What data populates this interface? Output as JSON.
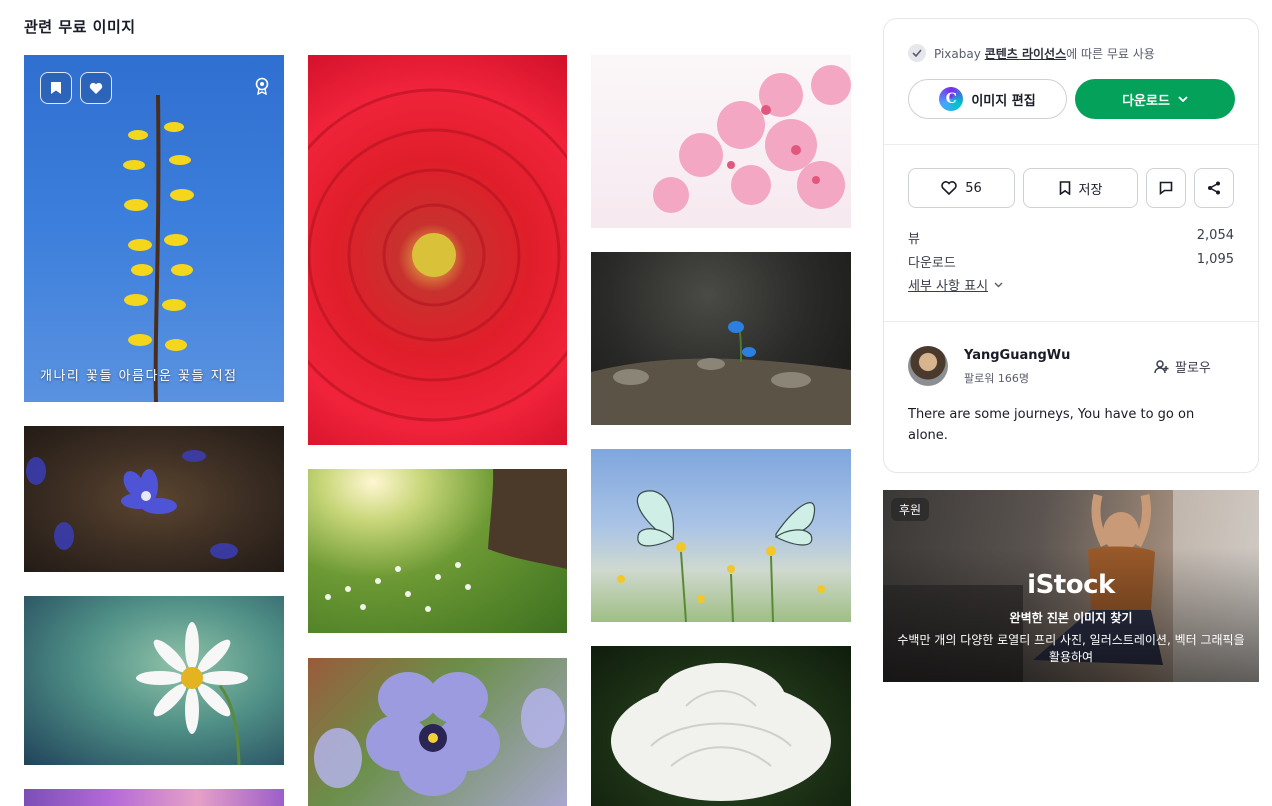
{
  "section_title": "관련 무료 이미지",
  "tiles": [
    {
      "caption": "개나리 꽃들 아름다운 꽃들 지점"
    }
  ],
  "panel": {
    "license_prefix": "Pixabay ",
    "license_link": "콘텐츠 라이선스",
    "license_suffix": "에 따른 무료 사용",
    "edit_label": "이미지 편집",
    "download_label": "다운로드",
    "like_count": "56",
    "save_label": "저장",
    "stats": [
      {
        "label": "뷰",
        "value": "2,054"
      },
      {
        "label": "다운로드",
        "value": "1,095"
      }
    ],
    "details_label": "세부 사항 표시",
    "author": {
      "name": "YangGuangWu",
      "followers": "팔로워 166명",
      "follow_label": "팔로우",
      "bio": "There are some journeys, You have to go on alone."
    }
  },
  "ad": {
    "badge": "후원",
    "logo": "iStock",
    "headline": "완벽한 진본 이미지 찾기",
    "subtext": "수백만 개의 다양한 로열티 프리 사진, 일러스트레이션, 벡터 그래픽을 활용하여"
  },
  "colors": {
    "accent_green": "#04a15a",
    "text_dark": "#191b26",
    "border": "#cfd1d8"
  }
}
